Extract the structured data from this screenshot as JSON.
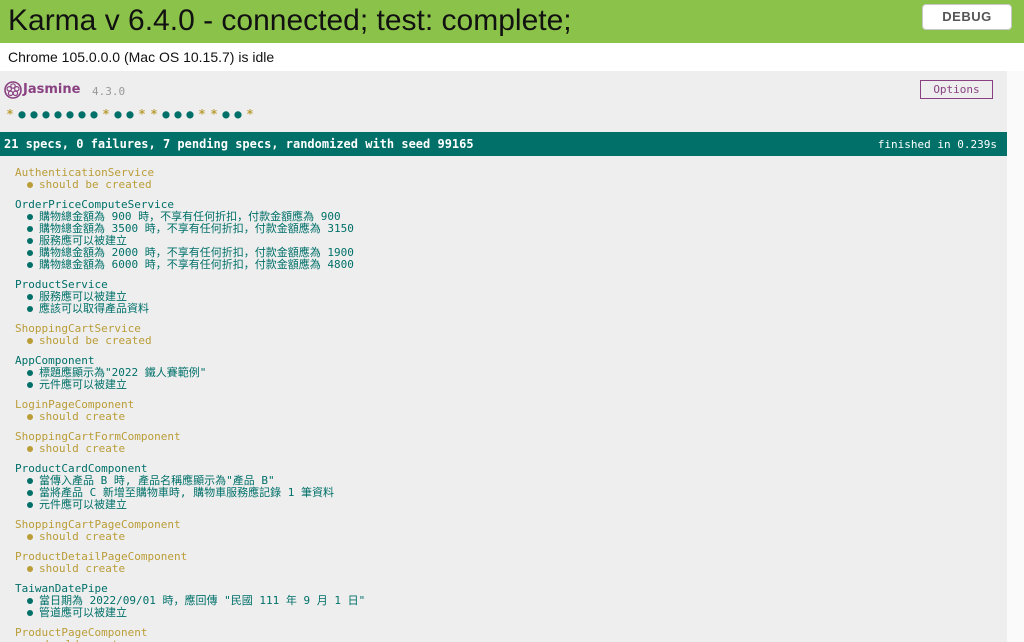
{
  "banner": {
    "title": "Karma v 6.4.0 - connected; test: complete;",
    "debug_label": "DEBUG",
    "color": "#8bc34a"
  },
  "browser_status": "Chrome 105.0.0.0 (Mac OS 10.15.7) is idle",
  "jasmine": {
    "logo_text": "Jasmine",
    "version": "4.3.0",
    "options_label": "Options",
    "logo_icon": "jasmine-flower-icon",
    "colors": {
      "passed": "#007069",
      "pending": "#ba9d37",
      "brand": "#8a4182"
    }
  },
  "symbols": [
    "pending",
    "passed",
    "passed",
    "passed",
    "passed",
    "passed",
    "passed",
    "passed",
    "pending",
    "passed",
    "passed",
    "pending",
    "pending",
    "passed",
    "passed",
    "passed",
    "pending",
    "pending",
    "passed",
    "passed",
    "pending"
  ],
  "summary": {
    "text": "21 specs, 0 failures, 7 pending specs, randomized with seed 99165",
    "duration": "finished in 0.239s"
  },
  "suites": [
    {
      "name": "AuthenticationService",
      "status": "pending",
      "specs": [
        {
          "text": "should be created",
          "status": "pending"
        }
      ]
    },
    {
      "name": "OrderPriceComputeService",
      "status": "passed",
      "specs": [
        {
          "text": "購物總金額為 900 時，不享有任何折扣，付款金額應為 900",
          "status": "passed"
        },
        {
          "text": "購物總金額為 3500 時，不享有任何折扣，付款金額應為 3150",
          "status": "passed"
        },
        {
          "text": "服務應可以被建立",
          "status": "passed"
        },
        {
          "text": "購物總金額為 2000 時，不享有任何折扣，付款金額應為 1900",
          "status": "passed"
        },
        {
          "text": "購物總金額為 6000 時，不享有任何折扣，付款金額應為 4800",
          "status": "passed"
        }
      ]
    },
    {
      "name": "ProductService",
      "status": "passed",
      "specs": [
        {
          "text": "服務應可以被建立",
          "status": "passed"
        },
        {
          "text": "應該可以取得產品資料",
          "status": "passed"
        }
      ]
    },
    {
      "name": "ShoppingCartService",
      "status": "pending",
      "specs": [
        {
          "text": "should be created",
          "status": "pending"
        }
      ]
    },
    {
      "name": "AppComponent",
      "status": "passed",
      "specs": [
        {
          "text": "標題應顯示為\"2022 鐵人賽範例\"",
          "status": "passed"
        },
        {
          "text": "元件應可以被建立",
          "status": "passed"
        }
      ]
    },
    {
      "name": "LoginPageComponent",
      "status": "pending",
      "specs": [
        {
          "text": "should create",
          "status": "pending"
        }
      ]
    },
    {
      "name": "ShoppingCartFormComponent",
      "status": "pending",
      "specs": [
        {
          "text": "should create",
          "status": "pending"
        }
      ]
    },
    {
      "name": "ProductCardComponent",
      "status": "passed",
      "specs": [
        {
          "text": "當傳入產品 B 時, 產品名稱應顯示為\"產品 B\"",
          "status": "passed"
        },
        {
          "text": "當將產品 C 新增至購物車時, 購物車服務應記錄 1 筆資料",
          "status": "passed"
        },
        {
          "text": "元件應可以被建立",
          "status": "passed"
        }
      ]
    },
    {
      "name": "ShoppingCartPageComponent",
      "status": "pending",
      "specs": [
        {
          "text": "should create",
          "status": "pending"
        }
      ]
    },
    {
      "name": "ProductDetailPageComponent",
      "status": "pending",
      "specs": [
        {
          "text": "should create",
          "status": "pending"
        }
      ]
    },
    {
      "name": "TaiwanDatePipe",
      "status": "passed",
      "specs": [
        {
          "text": "當日期為 2022/09/01 時，應回傳 \"民國 111 年 9 月 1 日\"",
          "status": "passed"
        },
        {
          "text": "管道應可以被建立",
          "status": "passed"
        }
      ]
    },
    {
      "name": "ProductPageComponent",
      "status": "pending",
      "specs": [
        {
          "text": "should create",
          "status": "pending"
        }
      ]
    }
  ]
}
